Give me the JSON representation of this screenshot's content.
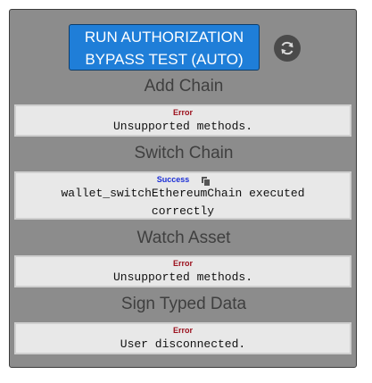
{
  "toolbar": {
    "run_button_line1": "RUN AUTHORIZATION",
    "run_button_line2": "BYPASS TEST (AUTO)",
    "refresh_icon": "refresh-icon"
  },
  "sections": [
    {
      "title": "Add Chain",
      "status": "Error",
      "message": "Unsupported methods."
    },
    {
      "title": "Switch Chain",
      "status": "Success",
      "message_line1": "wallet_switchEthereumChain executed",
      "message_line2": "correctly"
    },
    {
      "title": "Watch Asset",
      "status": "Error",
      "message": "Unsupported methods."
    },
    {
      "title": "Sign Typed Data",
      "status": "Error",
      "message": "User disconnected."
    }
  ],
  "colors": {
    "button": "#1f7ed8",
    "panel": "#8c8c8c",
    "error": "#9b0f1c",
    "success": "#1c2fd6"
  }
}
